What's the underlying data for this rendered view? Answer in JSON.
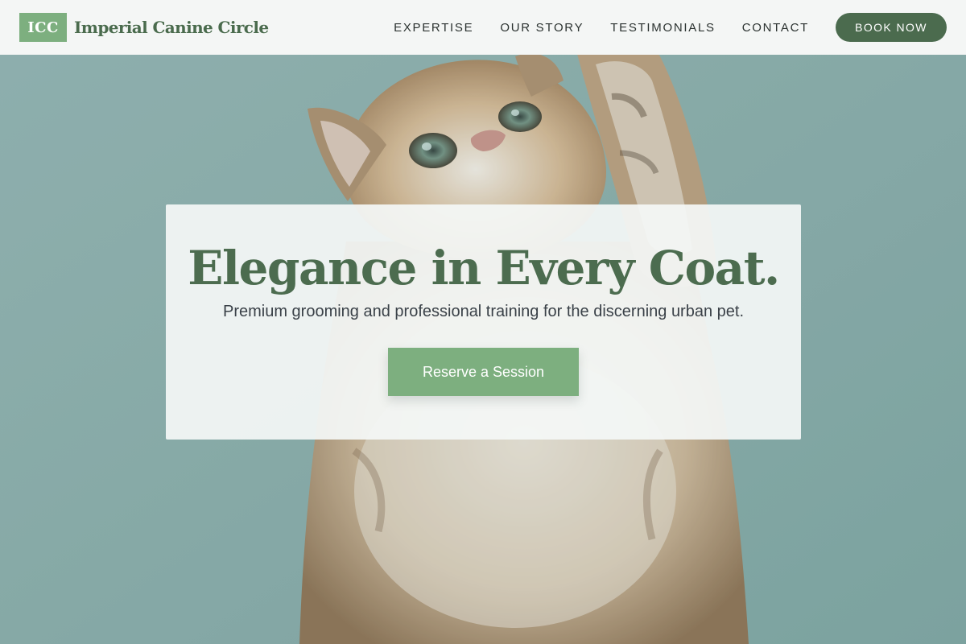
{
  "brand": {
    "badge": "ICC",
    "name": "Imperial Canine Circle"
  },
  "nav": {
    "items": [
      {
        "label": "EXPERTISE"
      },
      {
        "label": "OUR STORY"
      },
      {
        "label": "TESTIMONIALS"
      },
      {
        "label": "CONTACT"
      }
    ],
    "cta_label": "BOOK NOW"
  },
  "hero": {
    "title": "Elegance in Every Coat.",
    "subtitle": "Premium grooming and professional training for the discerning urban pet.",
    "button_label": "Reserve a Session",
    "background_image": "kitten-reaching-up-photo"
  },
  "colors": {
    "brand_green": "#4b6b4e",
    "accent_green": "#7daf7f",
    "header_bg": "#f4f6f5",
    "hero_bg": "#86a8a6"
  }
}
